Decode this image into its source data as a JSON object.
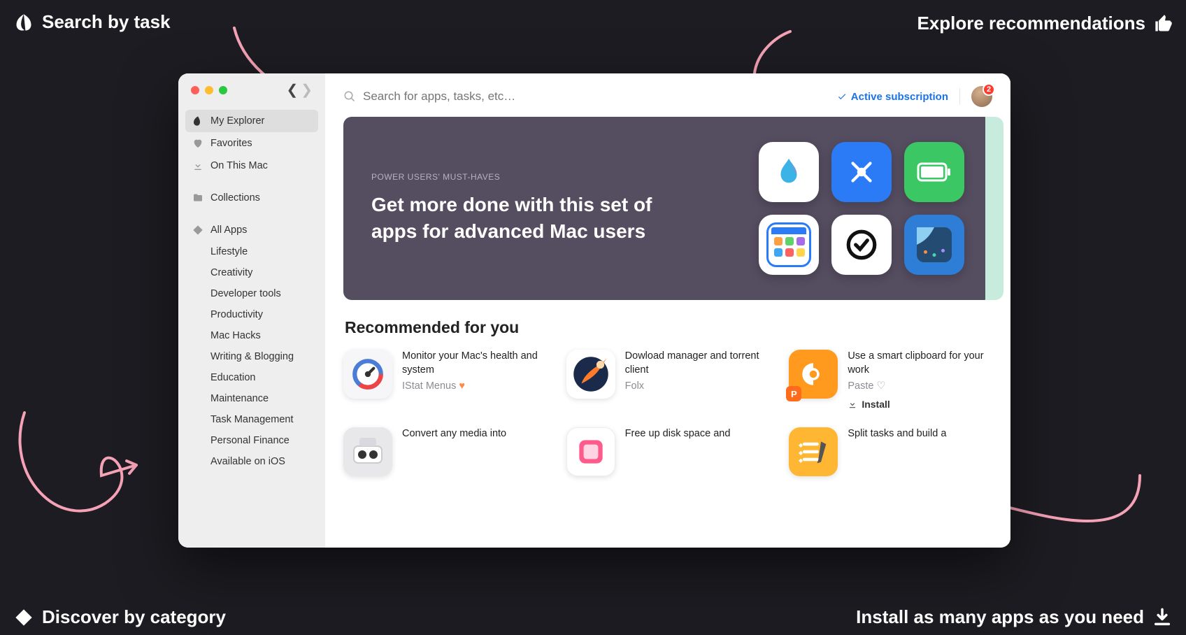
{
  "callouts": {
    "top_left": "Search by task",
    "top_right": "Explore recommendations",
    "bottom_left": "Discover by category",
    "bottom_right": "Install as many apps as you need"
  },
  "window": {
    "search_placeholder": "Search for apps, tasks, etc…",
    "subscription_label": "Active subscription",
    "avatar_badge": "2"
  },
  "sidebar": {
    "items": [
      {
        "icon": "leaf",
        "label": "My Explorer",
        "active": true
      },
      {
        "icon": "heart",
        "label": "Favorites"
      },
      {
        "icon": "download",
        "label": "On This Mac"
      },
      {
        "icon": "folder",
        "label": "Collections"
      },
      {
        "icon": "diamond",
        "label": "All Apps"
      }
    ],
    "categories": [
      "Lifestyle",
      "Creativity",
      "Developer tools",
      "Productivity",
      "Mac Hacks",
      "Writing & Blogging",
      "Education",
      "Maintenance",
      "Task Management",
      "Personal Finance",
      "Available on iOS"
    ]
  },
  "hero": {
    "kicker": "POWER USERS' MUST-HAVES",
    "title": "Get more done with this set of apps for advanced Mac users"
  },
  "recommended": {
    "title": "Recommended for you",
    "items": [
      {
        "title": "Monitor your Mac's health and system",
        "app": "IStat Menus",
        "heart": "filled"
      },
      {
        "title": "Dowload manager and torrent client",
        "app": "Folx"
      },
      {
        "title": "Use a smart clipboard for your work",
        "app": "Paste",
        "heart": "empty",
        "install": "Install"
      },
      {
        "title": "Convert any media into",
        "app": ""
      },
      {
        "title": "Free up disk space and",
        "app": ""
      },
      {
        "title": "Split tasks and build a",
        "app": ""
      }
    ]
  }
}
